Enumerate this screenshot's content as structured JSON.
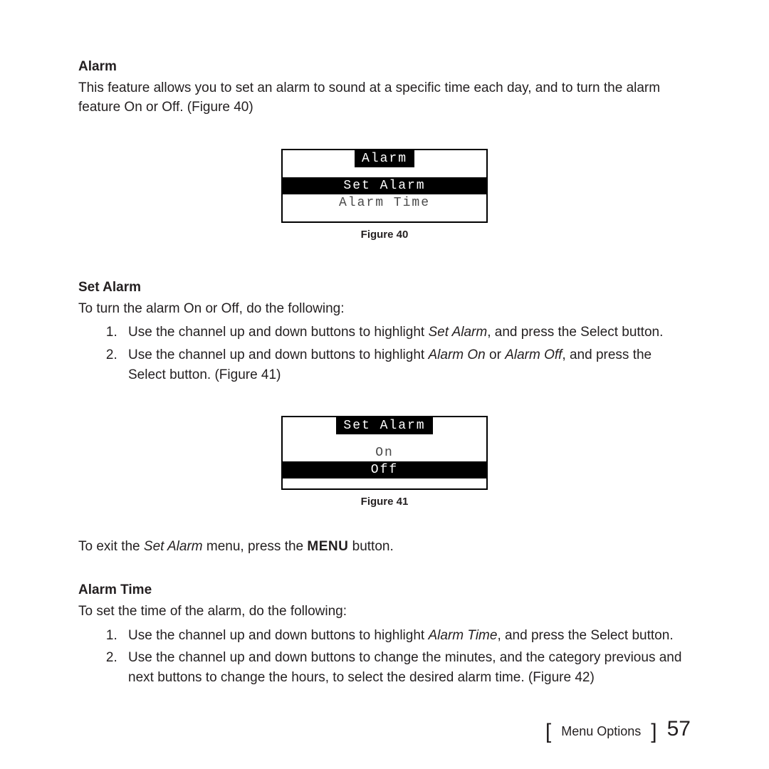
{
  "sections": {
    "alarm": {
      "heading": "Alarm",
      "body": "This feature allows you to set an alarm to sound at a specific time each day, and to turn the alarm feature On or Off. (Figure 40)"
    },
    "setAlarm": {
      "heading": "Set Alarm",
      "intro": "To turn the alarm On or Off, do the following:",
      "steps": {
        "s1_a": "Use the channel up and down buttons to highlight ",
        "s1_i": "Set Alarm",
        "s1_b": ", and press the Select button.",
        "s2_a": "Use the channel up and down buttons to highlight ",
        "s2_i1": "Alarm On",
        "s2_mid": " or ",
        "s2_i2": "Alarm Off",
        "s2_b": ", and press the Select button. (Figure 41)"
      },
      "exit_a": "To exit the ",
      "exit_i": "Set Alarm",
      "exit_b": " menu, press the ",
      "exit_bold": "MENU",
      "exit_c": " button."
    },
    "alarmTime": {
      "heading": "Alarm Time",
      "intro": "To set the time of the alarm, do the following:",
      "steps": {
        "s1_a": "Use the channel up and down buttons to highlight ",
        "s1_i": "Alarm Time",
        "s1_b": ", and press the Select button.",
        "s2": "Use the channel up and down buttons to change the minutes, and the category previous and next buttons to change the hours, to select the desired alarm time. (Figure 42)"
      }
    }
  },
  "figures": {
    "fig40": {
      "title": "Alarm",
      "row_selected": "Set Alarm",
      "row_other": "Alarm Time",
      "caption": "Figure 40"
    },
    "fig41": {
      "title": "Set Alarm",
      "row_other": "On",
      "row_selected": "Off",
      "caption": "Figure 41"
    }
  },
  "footer": {
    "section": "Menu Options",
    "page": "57"
  }
}
